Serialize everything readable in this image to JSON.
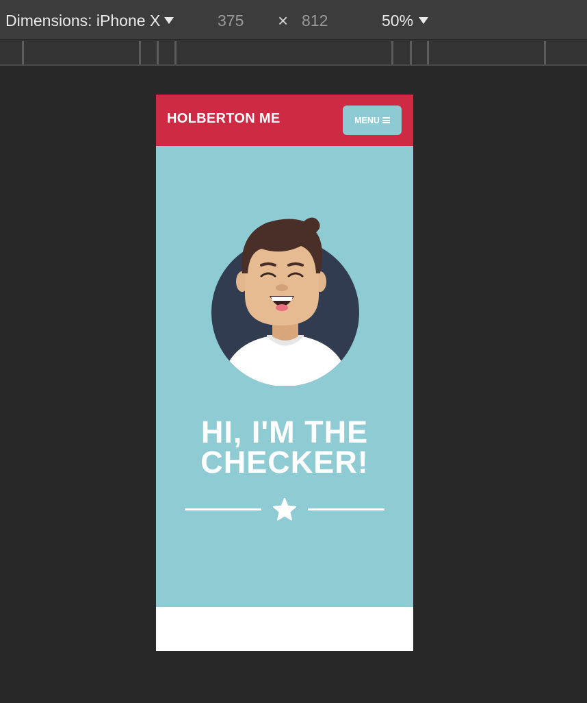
{
  "devtools": {
    "dimensions_label": "Dimensions: iPhone X",
    "width": "375",
    "times": "×",
    "height": "812",
    "zoom": "50%"
  },
  "site": {
    "brand": "HOLBERTON ME",
    "menu_label": "MENU",
    "hero_title": "HI, I'M THE CHECKER!"
  },
  "colors": {
    "header": "#cf2a44",
    "hero": "#8fcbd3",
    "menu_button": "#8dcad3",
    "avatar_circle": "#313c51"
  },
  "icons": {
    "dimensions_caret": "caret-down-icon",
    "zoom_caret": "caret-down-icon",
    "menu": "hamburger-icon",
    "divider": "star-icon"
  }
}
